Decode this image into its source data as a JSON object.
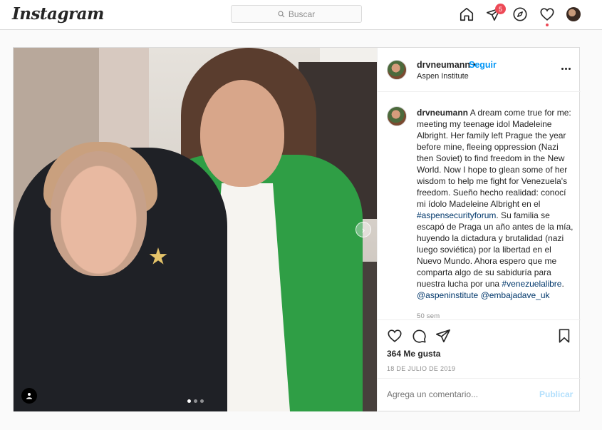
{
  "header": {
    "logo": "Instagram",
    "search_placeholder": "Buscar",
    "activity_badge": "5"
  },
  "post": {
    "username": "drvneumann",
    "follow_label": "Seguir",
    "location": "Aspen Institute",
    "caption": {
      "username": "drvneumann",
      "parts": [
        " A dream come true for me: meeting my teenage idol Madeleine Albright. Her family left Prague the year before mine, fleeing oppression (Nazi then Soviet) to find freedom in the New World. Now I hope to glean some of her wisdom to help me fight for Venezuela's freedom. Sueño hecho realidad: conocí mi ídolo Madeleine Albright en el ",
        "#aspensecurityforum",
        ". Su familia se escapó de Praga un año antes de la mía, huyendo la dictadura y brutalidad (nazi luego soviética) por la libertad en el Nuevo Mundo. Ahora espero que me comparta algo de su sabiduría para nuestra lucha por una ",
        "#venezuelalibre",
        ". ",
        "@aspeninstitute",
        " ",
        "@embajadave_uk"
      ],
      "time_ago": "50 sem"
    },
    "likes": "364 Me gusta",
    "date": "18 DE JULIO DE 2019",
    "comment_placeholder": "Agrega un comentario...",
    "publish_label": "Publicar",
    "carousel_total": 3,
    "carousel_current": 1
  },
  "colors": {
    "accent": "#0095f6",
    "badge": "#ed4956",
    "link": "#00376b"
  }
}
